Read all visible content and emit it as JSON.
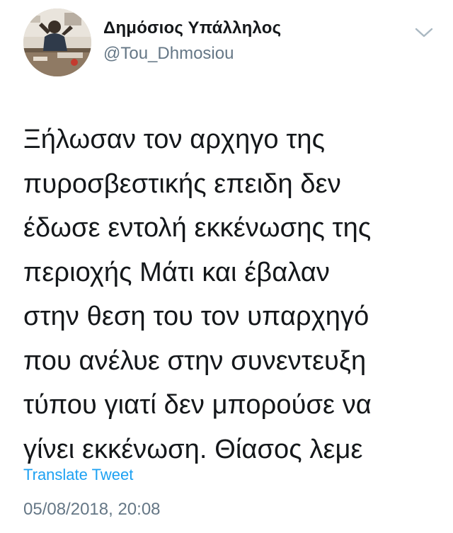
{
  "user": {
    "display_name": "Δημόσιος Υπάλληλος",
    "handle": "@Tou_Dhmosiou"
  },
  "tweet": {
    "text": "Ξήλωσαν τον αρχηγο της\nπυροσβεστικής επειδη δεν\nέδωσε εντολή εκκένωσης της\nπεριοχής Μάτι και έβαλαν\nστην θεση του τον υπαρχηγό\nπου ανέλυε στην συνεντευξη\nτύπου γιατί δεν μπορούσε να\nγίνει εκκένωση. Θίασος λεμε",
    "translate_label": "Translate Tweet",
    "timestamp": "05/08/2018, 20:08"
  },
  "icons": {
    "menu": "chevron-down-icon",
    "avatar": "profile-photo"
  },
  "colors": {
    "text": "#14171a",
    "secondary": "#657786",
    "link": "#1da1f2",
    "chevron": "#aab8c2"
  }
}
